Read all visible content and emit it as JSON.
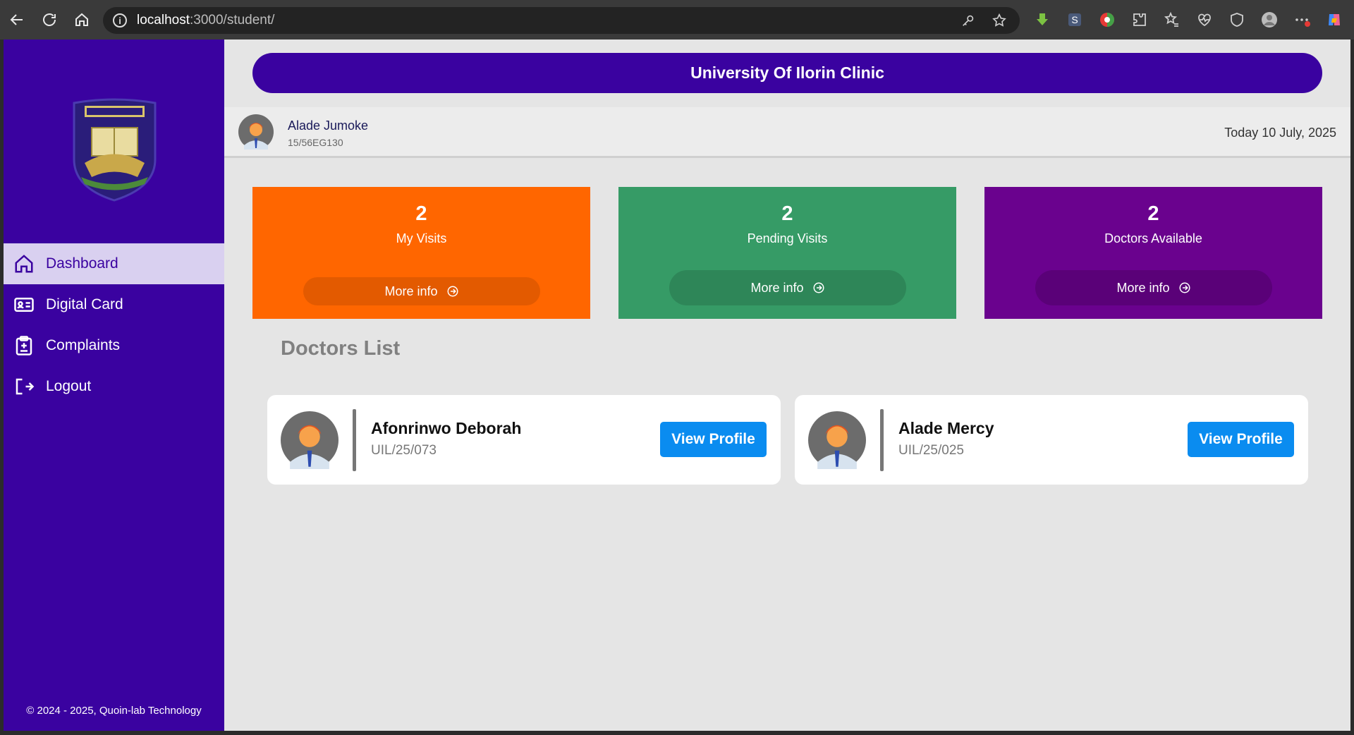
{
  "browser": {
    "url_host": "localhost",
    "url_path": ":3000/student/"
  },
  "sidebar": {
    "items": [
      {
        "label": "Dashboard",
        "icon": "home-icon",
        "active": true
      },
      {
        "label": "Digital Card",
        "icon": "id-card-icon",
        "active": false
      },
      {
        "label": "Complaints",
        "icon": "clipboard-icon",
        "active": false
      },
      {
        "label": "Logout",
        "icon": "logout-icon",
        "active": false
      }
    ],
    "footer": "© 2024 - 2025, Quoin-lab Technology"
  },
  "banner": {
    "title": "University Of Ilorin Clinic"
  },
  "user": {
    "name": "Alade Jumoke",
    "id": "15/56EG130",
    "today": "Today 10 July, 2025"
  },
  "stats": [
    {
      "value": "2",
      "label": "My Visits",
      "more": "More info",
      "color": "#ff6600"
    },
    {
      "value": "2",
      "label": "Pending Visits",
      "more": "More info",
      "color": "#369b66"
    },
    {
      "value": "2",
      "label": "Doctors Available",
      "more": "More info",
      "color": "#6a028e"
    }
  ],
  "doctors_section": {
    "title": "Doctors List"
  },
  "doctors": [
    {
      "name": "Afonrinwo Deborah",
      "id": "UIL/25/073",
      "button": "View Profile"
    },
    {
      "name": "Alade Mercy",
      "id": "UIL/25/025",
      "button": "View Profile"
    }
  ]
}
